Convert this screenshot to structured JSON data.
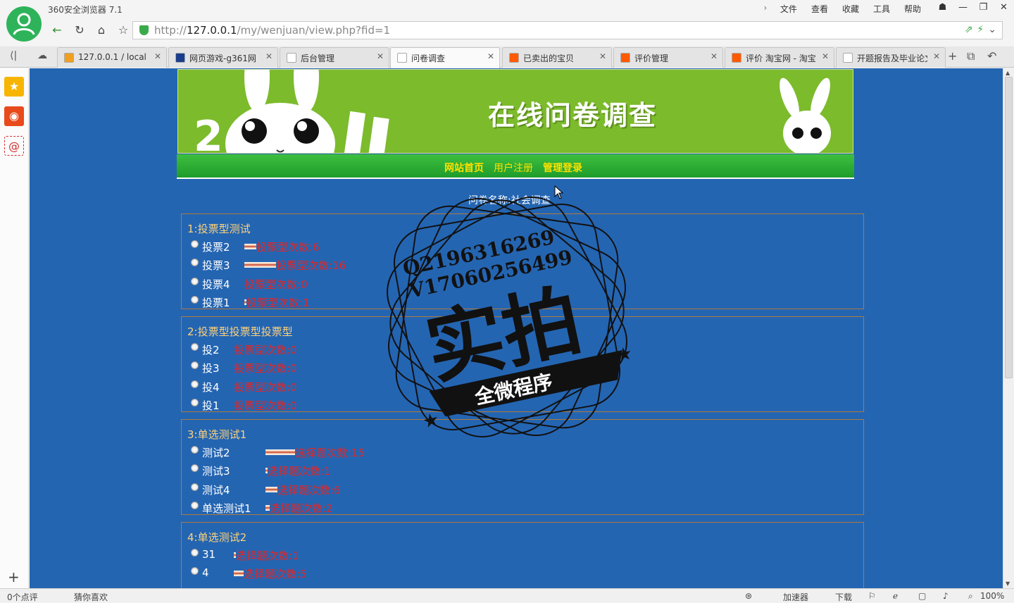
{
  "browser": {
    "app_title": "360安全浏览器 7.1",
    "menus": [
      "文件",
      "查看",
      "收藏",
      "工具",
      "帮助"
    ],
    "url_prefix": "http://",
    "url_host": "127.0.0.1",
    "url_path": "/my/wenjuan/view.php?fid=1",
    "tabs": [
      {
        "label": "127.0.0.1 / local",
        "icon_color": "#f0a020",
        "icon": "pma-icon"
      },
      {
        "label": "网页游戏-g361网",
        "icon_color": "#1a3e8c",
        "icon": "g361-icon"
      },
      {
        "label": "后台管理",
        "icon_color": "#ffffff",
        "icon": "page-icon"
      },
      {
        "label": "问卷调查",
        "icon_color": "#ffffff",
        "icon": "page-icon"
      },
      {
        "label": "已卖出的宝贝",
        "icon_color": "#ff5a00",
        "icon": "taobao-icon"
      },
      {
        "label": "评价管理",
        "icon_color": "#ff5a00",
        "icon": "taobao-icon"
      },
      {
        "label": "评价 淘宝网 - 淘宝",
        "icon_color": "#ff5a00",
        "icon": "taobao-icon"
      },
      {
        "label": "开题报告及毕业论文",
        "icon_color": "#ffffff",
        "icon": "chrome-icon"
      }
    ],
    "active_tab": 3,
    "status": {
      "comments": "0个点评",
      "guess": "猜你喜欢",
      "accelerator": "加速器",
      "download": "下载",
      "zoom": "100%"
    }
  },
  "page": {
    "banner_title": "在线问卷调查",
    "nav": [
      {
        "label": "网站首页",
        "style": "bold"
      },
      {
        "label": "用户注册",
        "style": "plain"
      },
      {
        "label": "管理登录",
        "style": "bold"
      }
    ],
    "survey_name": "问卷名称:社会调查",
    "questions": [
      {
        "title": "1:投票型测试",
        "options": [
          {
            "label": "投票2",
            "count_text": "投票型次数:6",
            "count": 6
          },
          {
            "label": "投票3",
            "count_text": "投票型次数:16",
            "count": 16
          },
          {
            "label": "投票4",
            "count_text": "投票型次数:0",
            "count": 0
          },
          {
            "label": "投票1",
            "count_text": "投票型次数:1",
            "count": 1
          }
        ]
      },
      {
        "title": "2:投票型投票型投票型",
        "options": [
          {
            "label": "投2",
            "count_text": "投票型次数:0",
            "count": 0
          },
          {
            "label": "投3",
            "count_text": "投票型次数:0",
            "count": 0
          },
          {
            "label": "投4",
            "count_text": "投票型次数:0",
            "count": 0
          },
          {
            "label": "投1",
            "count_text": "投票型次数:0",
            "count": 0
          }
        ]
      },
      {
        "title": "3:单选测试1",
        "options": [
          {
            "label": "测试2",
            "count_text": "选择题次数:15",
            "count": 15
          },
          {
            "label": "测试3",
            "count_text": "选择题次数:1",
            "count": 1
          },
          {
            "label": "测试4",
            "count_text": "选择题次数:6",
            "count": 6
          },
          {
            "label": "单选测试1",
            "count_text": "选择题次数:2",
            "count": 2
          }
        ]
      },
      {
        "title": "4:单选测试2",
        "options": [
          {
            "label": "31",
            "count_text": "选择题次数:1",
            "count": 1
          },
          {
            "label": "4",
            "count_text": "选择题次数:5",
            "count": 5
          }
        ]
      }
    ],
    "watermark": {
      "line1": "Q2196316269",
      "line2": "V17060256499",
      "big": "实拍",
      "ribbon": "全微程序"
    }
  }
}
